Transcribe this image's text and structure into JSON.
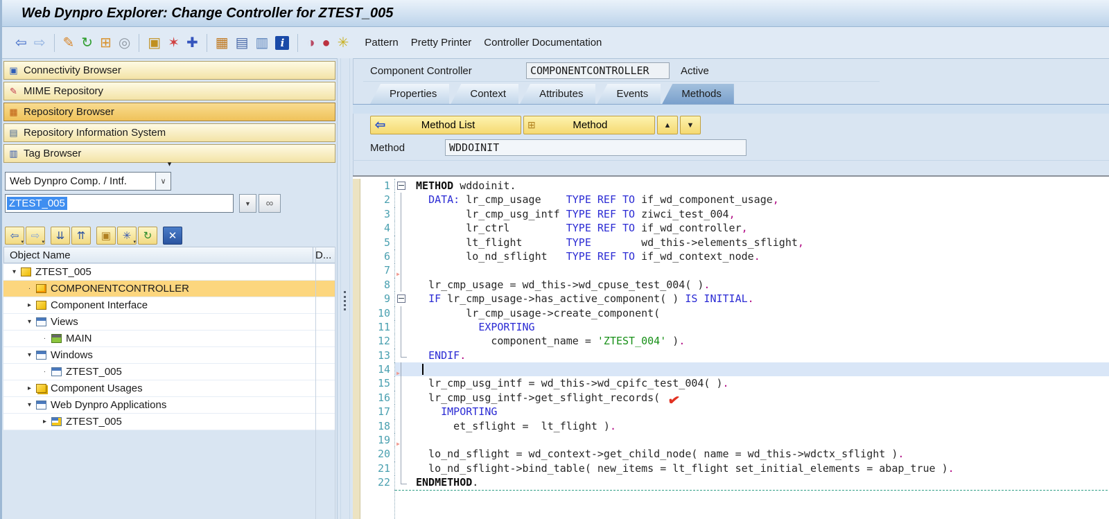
{
  "title": "Web Dynpro Explorer: Change Controller for ZTEST_005",
  "toolbar": {
    "icons": [
      {
        "name": "back-icon",
        "glyph": "⇦",
        "color": "#3a66c6"
      },
      {
        "name": "forward-icon",
        "glyph": "⇨",
        "color": "#8fb0e0"
      },
      {
        "sep": true
      },
      {
        "name": "display-change-icon",
        "glyph": "✎",
        "color": "#d8862a"
      },
      {
        "name": "refresh-icon",
        "glyph": "↻",
        "color": "#2f9e2f"
      },
      {
        "name": "copy-icon",
        "glyph": "⊞",
        "color": "#d8922e"
      },
      {
        "name": "spiral-icon",
        "glyph": "◎",
        "color": "#8f98a2"
      },
      {
        "sep": true
      },
      {
        "name": "hierarchy-arrow-icon",
        "glyph": "▣",
        "color": "#c09020"
      },
      {
        "name": "magic-wand-icon",
        "glyph": "✶",
        "color": "#d04040"
      },
      {
        "name": "navigate-icon",
        "glyph": "✚",
        "color": "#3555bd"
      },
      {
        "sep": true
      },
      {
        "name": "structure-icon",
        "glyph": "▦",
        "color": "#c07a22"
      },
      {
        "name": "layers-icon",
        "glyph": "▤",
        "color": "#4a6aa8"
      },
      {
        "name": "table-view-icon",
        "glyph": "▥",
        "color": "#5a82ba"
      },
      {
        "name": "info-icon",
        "glyph": "i",
        "color": "#ffffff",
        "bg": "#1a4aa8",
        "box": true
      },
      {
        "sep": true
      },
      {
        "name": "runtime-analysis-icon",
        "glyph": "◑",
        "color": "#b84a64"
      },
      {
        "name": "sql-trace-icon",
        "glyph": "●",
        "color": "#bc3240"
      },
      {
        "name": "pattern-wand-icon",
        "glyph": "✳",
        "color": "#c8b020"
      }
    ],
    "buttons": [
      "Pattern",
      "Pretty Printer",
      "Controller Documentation"
    ]
  },
  "sidebar": {
    "browsers": [
      {
        "label": "Connectivity Browser",
        "icon": "connectivity",
        "glyph": "▣",
        "color": "#2e5cb8"
      },
      {
        "label": "MIME Repository",
        "icon": "mime",
        "glyph": "✎",
        "color": "#c23a4a"
      },
      {
        "label": "Repository Browser",
        "icon": "repository",
        "glyph": "▦",
        "color": "#bc5a10",
        "selected": true
      },
      {
        "label": "Repository Information System",
        "icon": "infosystem",
        "glyph": "▤",
        "color": "#46648c"
      },
      {
        "label": "Tag Browser",
        "icon": "tag",
        "glyph": "▥",
        "color": "#2a50a8"
      }
    ],
    "collapse_glyph": "▾",
    "object_type": "Web Dynpro Comp. / Intf.",
    "combo_chevron": "∨",
    "object_name": "ZTEST_005",
    "dropdown_glyph": "▼",
    "find_glyph": "∞",
    "nav_icons": [
      {
        "name": "nav-back-button",
        "glyph": "⇦",
        "color": "#2a5ac0",
        "caret": true
      },
      {
        "name": "nav-forward-button",
        "glyph": "⇨",
        "color": "#8aa8d8",
        "caret": true,
        "gap": true
      },
      {
        "name": "expand-all-button",
        "glyph": "⇊",
        "color": "#2a50a0"
      },
      {
        "name": "collapse-all-button",
        "glyph": "⇈",
        "color": "#2a50a0",
        "gap": true
      },
      {
        "name": "hierarchy-button",
        "glyph": "▣",
        "color": "#b08020"
      },
      {
        "name": "display-options-button",
        "glyph": "✳",
        "color": "#3858b0",
        "caret": true
      },
      {
        "name": "refresh-tree-button",
        "glyph": "↻",
        "color": "#2a8a2a",
        "gap": true
      },
      {
        "name": "close-browser-button",
        "glyph": "✕",
        "color": "#ffffff",
        "bg": true
      }
    ]
  },
  "tree": {
    "columns": [
      "Object Name",
      "D..."
    ],
    "items": [
      {
        "label": "ZTEST_005",
        "level": 0,
        "arrow": "open",
        "icon": "component"
      },
      {
        "label": "COMPONENTCONTROLLER",
        "level": 1,
        "arrow": "dot",
        "icon": "controller",
        "selected": true
      },
      {
        "label": "Component Interface",
        "level": 1,
        "arrow": "closed",
        "icon": "component"
      },
      {
        "label": "Views",
        "level": 1,
        "arrow": "open",
        "icon": "views"
      },
      {
        "label": "MAIN",
        "level": 2,
        "arrow": "dot",
        "icon": "view"
      },
      {
        "label": "Windows",
        "level": 1,
        "arrow": "open",
        "icon": "windows"
      },
      {
        "label": "ZTEST_005",
        "level": 2,
        "arrow": "dot",
        "icon": "window"
      },
      {
        "label": "Component Usages",
        "level": 1,
        "arrow": "closed",
        "icon": "usages"
      },
      {
        "label": "Web Dynpro Applications",
        "level": 1,
        "arrow": "open",
        "icon": "applications"
      },
      {
        "label": "ZTEST_005",
        "level": 2,
        "arrow": "closed",
        "icon": "application"
      }
    ]
  },
  "controller": {
    "label": "Component Controller",
    "name": "COMPONENTCONTROLLER",
    "status": "Active"
  },
  "tabs": {
    "items": [
      "Properties",
      "Context",
      "Attributes",
      "Events",
      "Methods"
    ],
    "selected": "Methods"
  },
  "method_bar": {
    "back_glyph": "⇦",
    "list_label": "Method List",
    "method_glyph": "⊞",
    "method_label": "Method",
    "up_glyph": "▲",
    "down_glyph": "▼",
    "field_label": "Method",
    "field_value": "WDDOINIT"
  },
  "colors": {
    "keyword": "#2b2bd4",
    "string": "#189018",
    "punctuation": "#b00682",
    "selected_row": "#fcd67e",
    "selection_bg": "#3f8ef0",
    "button_yellow": "#f5da72",
    "tab_selected": "#7aa0cc",
    "line_highlight": "#d9e6f7",
    "line_number": "#4aa0b0",
    "check_red": "#e23222"
  },
  "editor": {
    "lines": [
      {
        "n": 1,
        "fold": "box",
        "segs": [
          [
            "b",
            "METHOD"
          ],
          [
            "i",
            " wddoinit."
          ]
        ]
      },
      {
        "n": 2,
        "fold": "line",
        "segs": [
          [
            "i",
            "  "
          ],
          [
            "k",
            "DATA:"
          ],
          [
            "i",
            " lr_cmp_usage    "
          ],
          [
            "k",
            "TYPE REF TO"
          ],
          [
            "i",
            " if_wd_component_usage"
          ],
          [
            "p",
            ","
          ]
        ]
      },
      {
        "n": 3,
        "fold": "line",
        "segs": [
          [
            "i",
            "        lr_cmp_usg_intf "
          ],
          [
            "k",
            "TYPE REF TO"
          ],
          [
            "i",
            " ziwci_test_004"
          ],
          [
            "p",
            ","
          ]
        ]
      },
      {
        "n": 4,
        "fold": "line",
        "segs": [
          [
            "i",
            "        lr_ctrl         "
          ],
          [
            "k",
            "TYPE REF TO"
          ],
          [
            "i",
            " if_wd_controller"
          ],
          [
            "p",
            ","
          ]
        ]
      },
      {
        "n": 5,
        "fold": "line",
        "segs": [
          [
            "i",
            "        lt_flight       "
          ],
          [
            "k",
            "TYPE"
          ],
          [
            "i",
            "        wd_this->elements_sflight"
          ],
          [
            "p",
            ","
          ]
        ]
      },
      {
        "n": 6,
        "fold": "line",
        "segs": [
          [
            "i",
            "        lo_nd_sflight   "
          ],
          [
            "k",
            "TYPE REF TO"
          ],
          [
            "i",
            " if_wd_context_node"
          ],
          [
            "p",
            "."
          ]
        ]
      },
      {
        "n": 7,
        "fold": "line",
        "mark": true,
        "segs": []
      },
      {
        "n": 8,
        "fold": "line",
        "segs": [
          [
            "i",
            "  lr_cmp_usage = wd_this->wd_cpuse_test_004( )"
          ],
          [
            "p",
            "."
          ]
        ]
      },
      {
        "n": 9,
        "fold": "box",
        "segs": [
          [
            "i",
            "  "
          ],
          [
            "k",
            "IF"
          ],
          [
            "i",
            " lr_cmp_usage->has_active_component( ) "
          ],
          [
            "k",
            "IS INITIAL"
          ],
          [
            "p",
            "."
          ]
        ]
      },
      {
        "n": 10,
        "fold": "line",
        "segs": [
          [
            "i",
            "        lr_cmp_usage->create_component("
          ]
        ]
      },
      {
        "n": 11,
        "fold": "line",
        "segs": [
          [
            "i",
            "          "
          ],
          [
            "k",
            "EXPORTING"
          ]
        ]
      },
      {
        "n": 12,
        "fold": "line",
        "segs": [
          [
            "i",
            "            component_name = "
          ],
          [
            "s",
            "'ZTEST_004'"
          ],
          [
            "i",
            " )"
          ],
          [
            "p",
            "."
          ]
        ]
      },
      {
        "n": 13,
        "fold": "end",
        "segs": [
          [
            "i",
            "  "
          ],
          [
            "k",
            "ENDIF"
          ],
          [
            "p",
            "."
          ]
        ]
      },
      {
        "n": 14,
        "fold": "line",
        "mark": true,
        "hl": true,
        "cursor": true,
        "segs": [
          [
            "i",
            " "
          ]
        ]
      },
      {
        "n": 15,
        "fold": "line",
        "segs": [
          [
            "i",
            "  lr_cmp_usg_intf = wd_this->wd_cpifc_test_004( )"
          ],
          [
            "p",
            "."
          ]
        ]
      },
      {
        "n": 16,
        "fold": "line",
        "check": true,
        "segs": [
          [
            "i",
            "  lr_cmp_usg_intf->get_sflight_records( "
          ]
        ]
      },
      {
        "n": 17,
        "fold": "line",
        "segs": [
          [
            "i",
            "    "
          ],
          [
            "k",
            "IMPORTING"
          ]
        ]
      },
      {
        "n": 18,
        "fold": "line",
        "segs": [
          [
            "i",
            "      et_sflight =  lt_flight )"
          ],
          [
            "p",
            "."
          ]
        ]
      },
      {
        "n": 19,
        "fold": "line",
        "mark": true,
        "segs": []
      },
      {
        "n": 20,
        "fold": "line",
        "segs": [
          [
            "i",
            "  lo_nd_sflight = wd_context->get_child_node( name = wd_this->wdctx_sflight )"
          ],
          [
            "p",
            "."
          ]
        ]
      },
      {
        "n": 21,
        "fold": "line",
        "segs": [
          [
            "i",
            "  lo_nd_sflight->bind_table( new_items = lt_flight set_initial_elements = abap_true )"
          ],
          [
            "p",
            "."
          ]
        ]
      },
      {
        "n": 22,
        "fold": "end",
        "segs": [
          [
            "b",
            "ENDMETHOD"
          ],
          [
            "i",
            "."
          ]
        ]
      }
    ]
  }
}
